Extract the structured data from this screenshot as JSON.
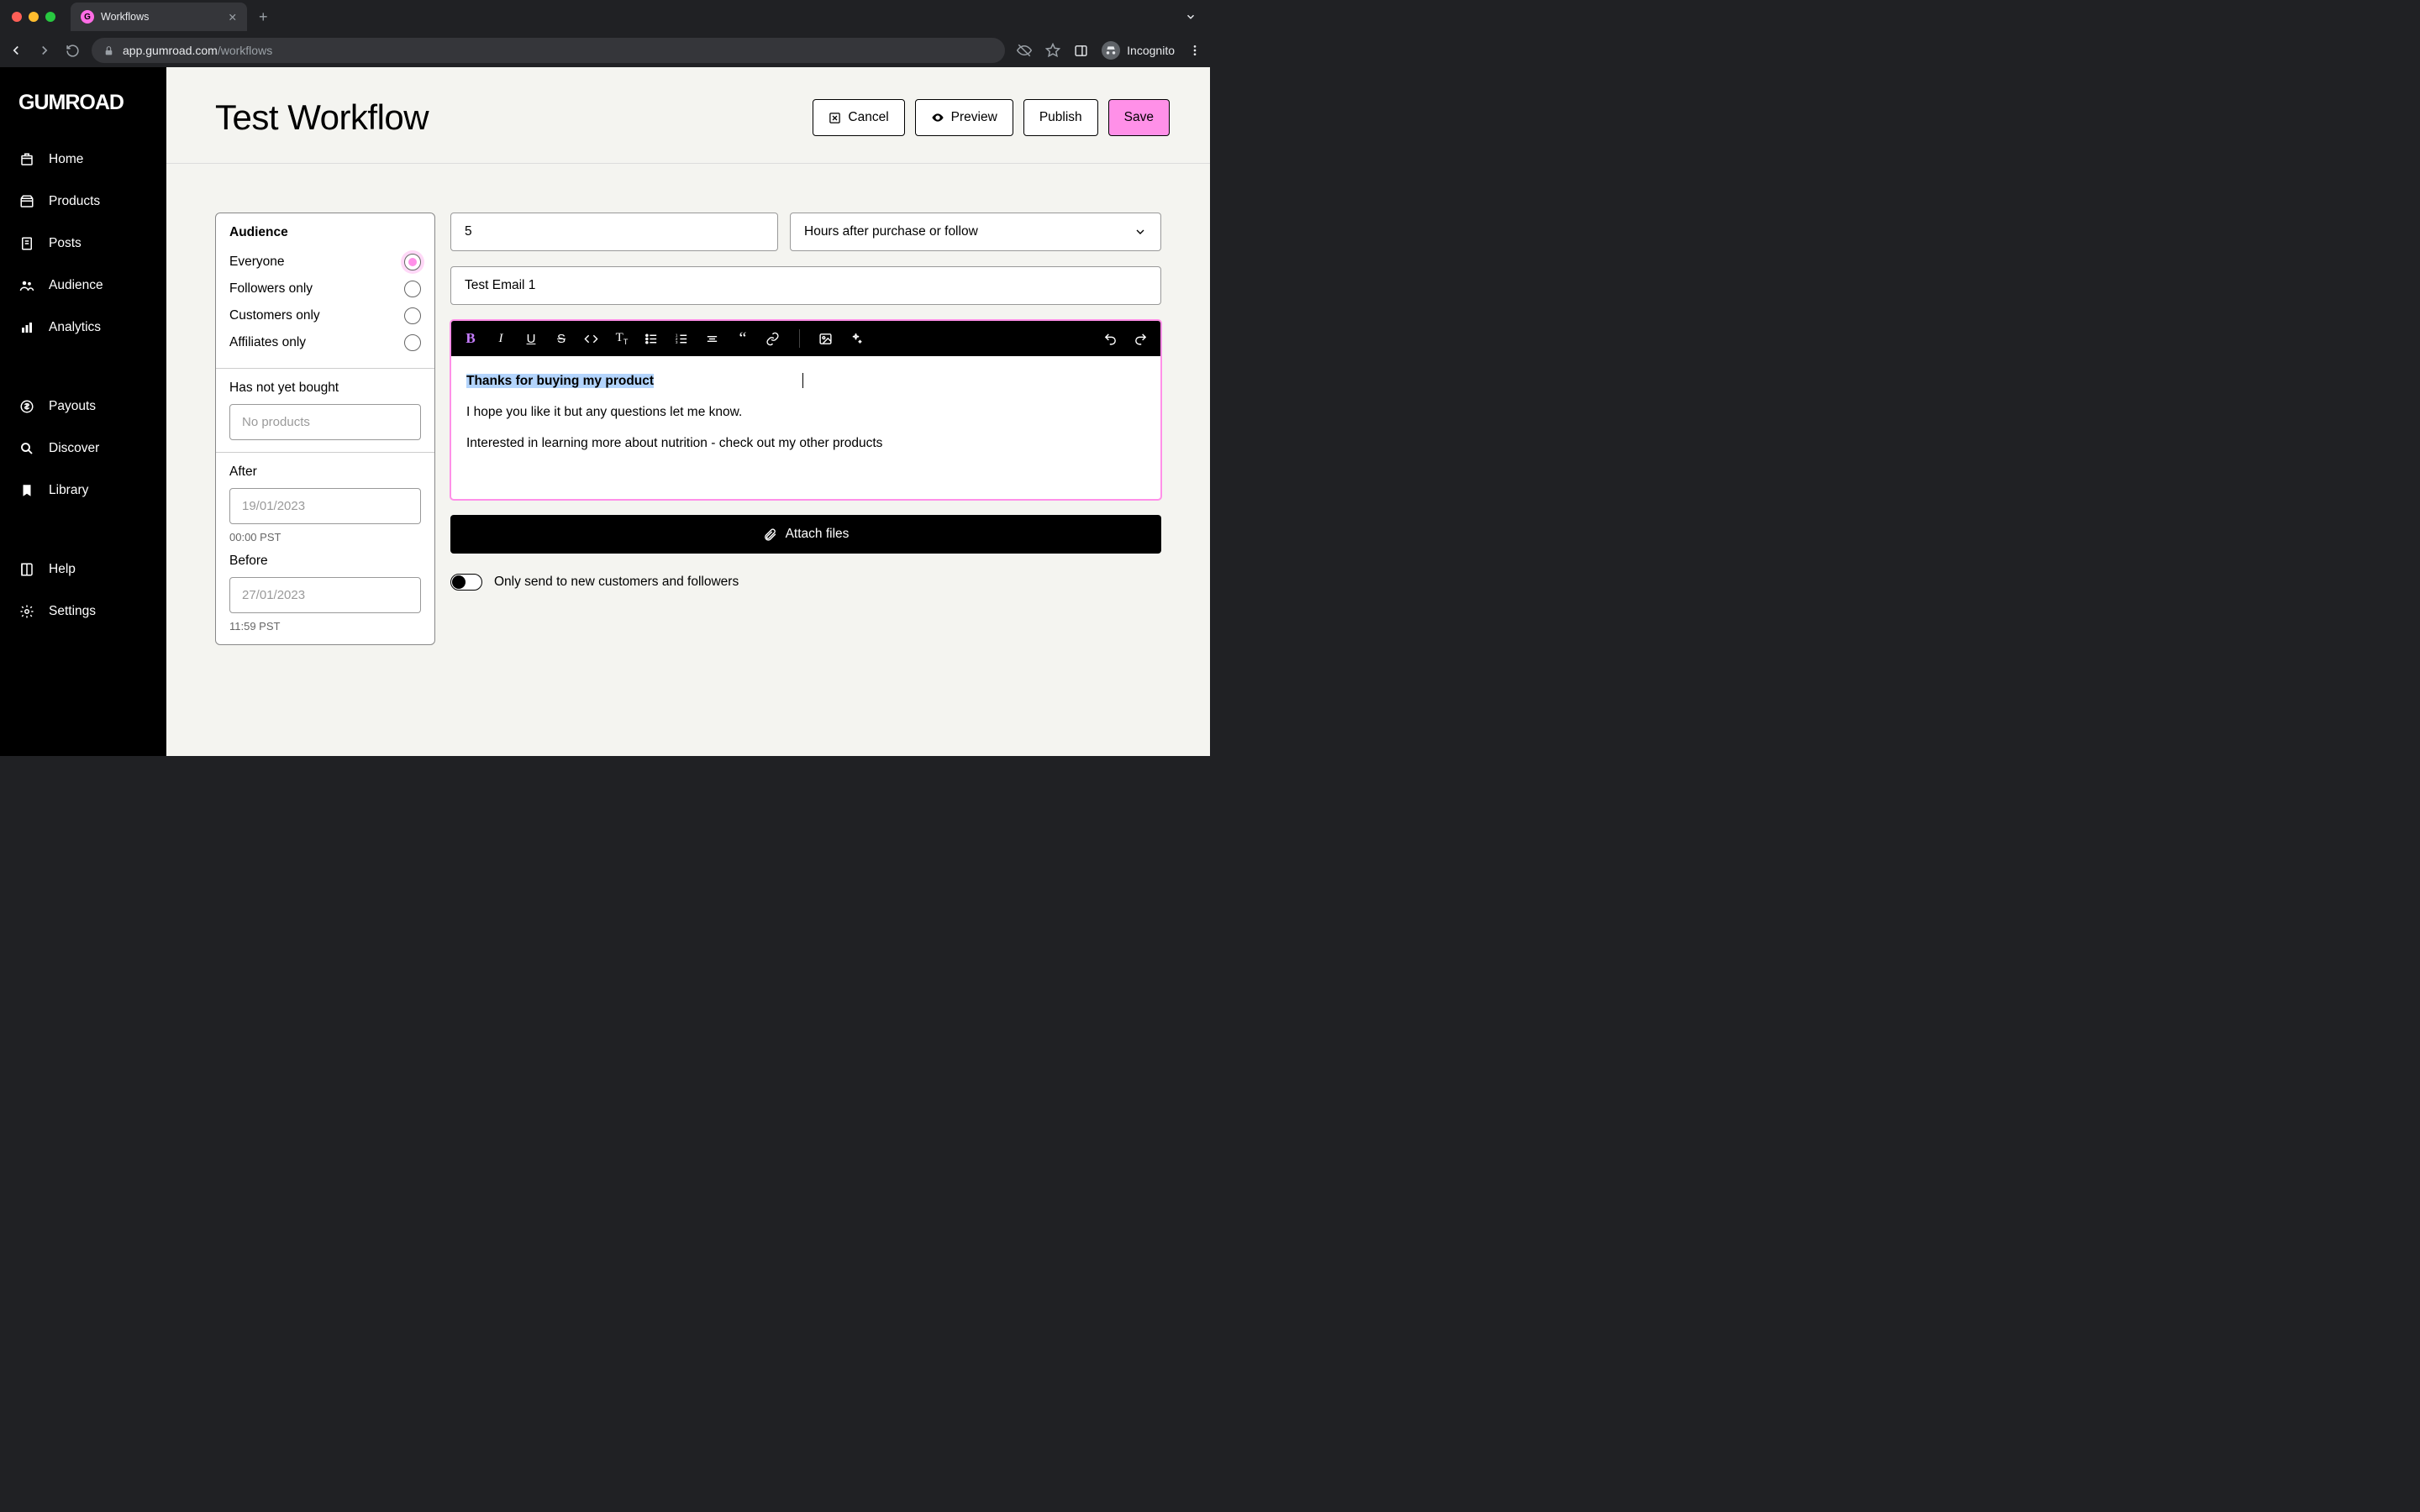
{
  "browser": {
    "tab_title": "Workflows",
    "url_host": "app.gumroad.com",
    "url_path": "/workflows",
    "incognito_label": "Incognito"
  },
  "sidebar": {
    "logo": "GUMROAD",
    "items": [
      {
        "icon": "home-icon",
        "label": "Home"
      },
      {
        "icon": "tag-icon",
        "label": "Products"
      },
      {
        "icon": "doc-icon",
        "label": "Posts"
      },
      {
        "icon": "people-icon",
        "label": "Audience"
      },
      {
        "icon": "chart-icon",
        "label": "Analytics"
      }
    ],
    "items2": [
      {
        "icon": "dollar-icon",
        "label": "Payouts"
      },
      {
        "icon": "search-icon",
        "label": "Discover"
      },
      {
        "icon": "bookmark-icon",
        "label": "Library"
      }
    ],
    "items3": [
      {
        "icon": "help-icon",
        "label": "Help"
      },
      {
        "icon": "gear-icon",
        "label": "Settings"
      }
    ]
  },
  "header": {
    "title": "Test Workflow",
    "cancel": "Cancel",
    "preview": "Preview",
    "publish": "Publish",
    "save": "Save"
  },
  "audience_card": {
    "title": "Audience",
    "options": [
      "Everyone",
      "Followers only",
      "Customers only",
      "Affiliates only"
    ],
    "selected": 0,
    "not_bought_label": "Has not yet bought",
    "not_bought_placeholder": "No products",
    "after_label": "After",
    "after_placeholder": "19/01/2023",
    "after_time": "00:00 PST",
    "before_label": "Before",
    "before_placeholder": "27/01/2023",
    "before_time": "11:59 PST"
  },
  "email": {
    "delay_value": "5",
    "trigger_label": "Hours after purchase or follow",
    "subject": "Test Email 1",
    "body_selected": "Thanks for buying my product",
    "body_line2": "I hope you like it but any questions let me know.",
    "body_line3": "Interested in learning more about nutrition - check out my other products",
    "attach_label": "Attach files",
    "only_new_label": "Only send to new customers and followers"
  }
}
